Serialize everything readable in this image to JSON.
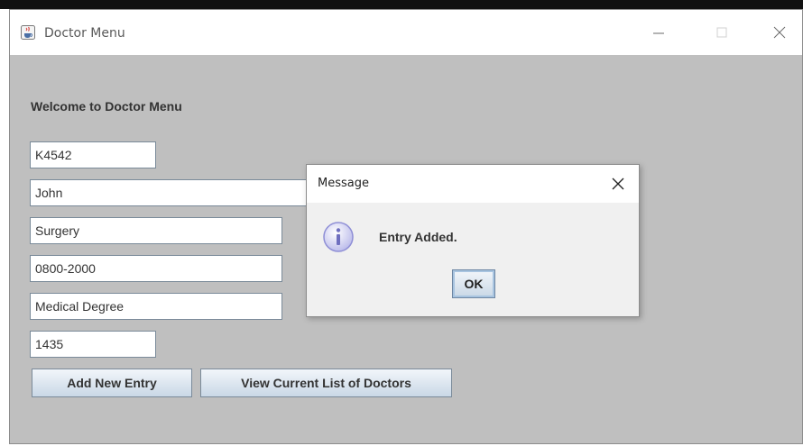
{
  "window": {
    "title": "Doctor Menu",
    "icon": "java-cup-icon"
  },
  "form": {
    "welcome": "Welcome to Doctor Menu",
    "fields": [
      {
        "value": "K4542"
      },
      {
        "value": "John"
      },
      {
        "value": "Surgery"
      },
      {
        "value": "0800-2000"
      },
      {
        "value": "Medical Degree"
      },
      {
        "value": "1435"
      }
    ],
    "buttons": {
      "add": "Add New Entry",
      "view": "View Current List of Doctors"
    }
  },
  "dialog": {
    "title": "Message",
    "message": "Entry Added.",
    "ok": "OK",
    "icon": "info-icon"
  },
  "colors": {
    "client_background": "#bfbfbf",
    "button_gradient_bottom": "#c9d8e6",
    "info_icon": "#8f8fd6"
  }
}
